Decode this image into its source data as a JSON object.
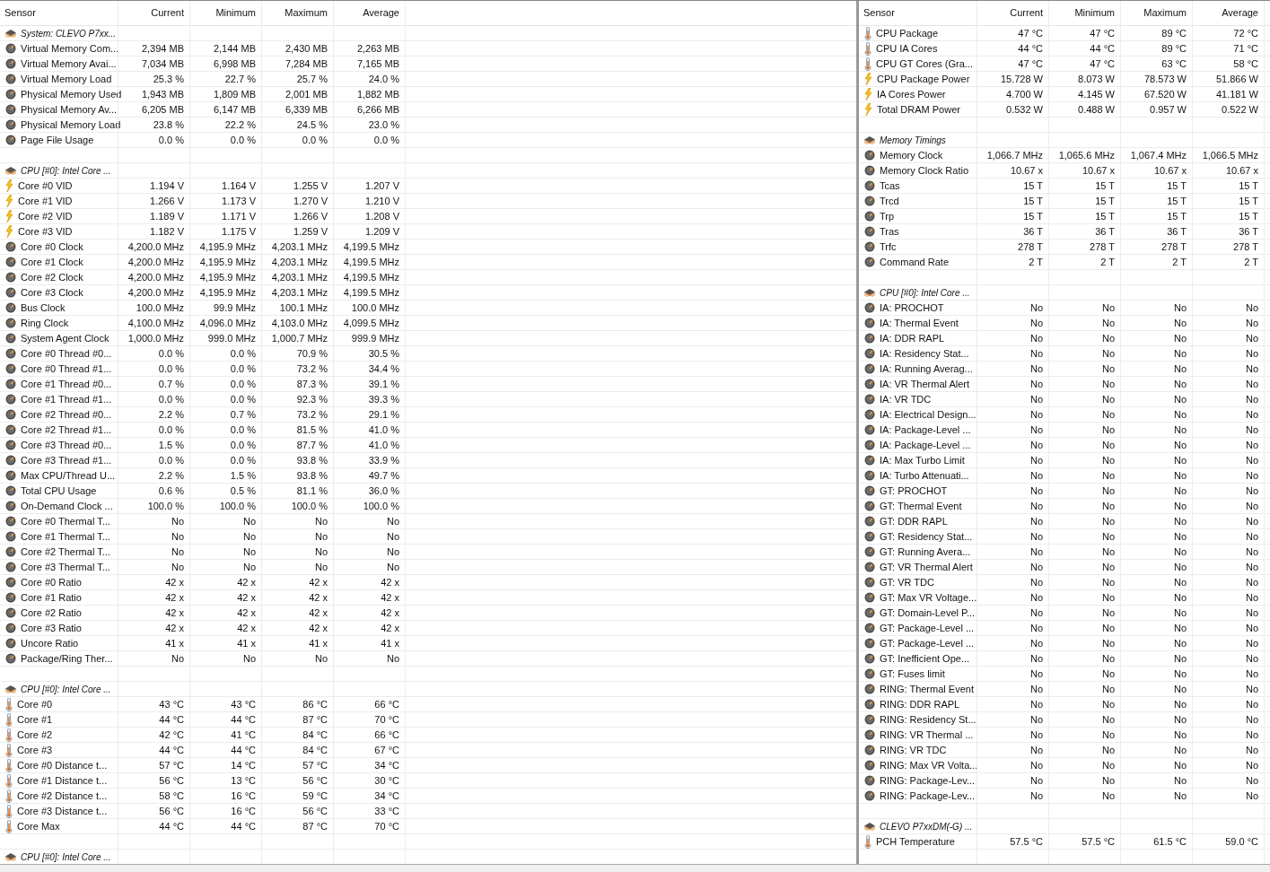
{
  "panels": [
    {
      "columns": [
        "Sensor",
        "Current",
        "Minimum",
        "Maximum",
        "Average"
      ],
      "rows": [
        {
          "kind": "group",
          "label": "System: CLEVO P7xx..."
        },
        {
          "kind": "gauge",
          "label": "Virtual Memory Com...",
          "values": [
            "2,394 MB",
            "2,144 MB",
            "2,430 MB",
            "2,263 MB"
          ]
        },
        {
          "kind": "gauge",
          "label": "Virtual Memory Avai...",
          "values": [
            "7,034 MB",
            "6,998 MB",
            "7,284 MB",
            "7,165 MB"
          ]
        },
        {
          "kind": "gauge",
          "label": "Virtual Memory Load",
          "values": [
            "25.3 %",
            "22.7 %",
            "25.7 %",
            "24.0 %"
          ]
        },
        {
          "kind": "gauge",
          "label": "Physical Memory Used",
          "values": [
            "1,943 MB",
            "1,809 MB",
            "2,001 MB",
            "1,882 MB"
          ]
        },
        {
          "kind": "gauge",
          "label": "Physical Memory Av...",
          "values": [
            "6,205 MB",
            "6,147 MB",
            "6,339 MB",
            "6,266 MB"
          ]
        },
        {
          "kind": "gauge",
          "label": "Physical Memory Load",
          "values": [
            "23.8 %",
            "22.2 %",
            "24.5 %",
            "23.0 %"
          ]
        },
        {
          "kind": "gauge",
          "label": "Page File Usage",
          "values": [
            "0.0 %",
            "0.0 %",
            "0.0 %",
            "0.0 %"
          ]
        },
        {
          "kind": "blank"
        },
        {
          "kind": "group",
          "label": "CPU [#0]: Intel Core ..."
        },
        {
          "kind": "bolt",
          "label": "Core #0 VID",
          "values": [
            "1.194 V",
            "1.164 V",
            "1.255 V",
            "1.207 V"
          ]
        },
        {
          "kind": "bolt",
          "label": "Core #1 VID",
          "values": [
            "1.266 V",
            "1.173 V",
            "1.270 V",
            "1.210 V"
          ]
        },
        {
          "kind": "bolt",
          "label": "Core #2 VID",
          "values": [
            "1.189 V",
            "1.171 V",
            "1.266 V",
            "1.208 V"
          ]
        },
        {
          "kind": "bolt",
          "label": "Core #3 VID",
          "values": [
            "1.182 V",
            "1.175 V",
            "1.259 V",
            "1.209 V"
          ]
        },
        {
          "kind": "gauge",
          "label": "Core #0 Clock",
          "values": [
            "4,200.0 MHz",
            "4,195.9 MHz",
            "4,203.1 MHz",
            "4,199.5 MHz"
          ]
        },
        {
          "kind": "gauge",
          "label": "Core #1 Clock",
          "values": [
            "4,200.0 MHz",
            "4,195.9 MHz",
            "4,203.1 MHz",
            "4,199.5 MHz"
          ]
        },
        {
          "kind": "gauge",
          "label": "Core #2 Clock",
          "values": [
            "4,200.0 MHz",
            "4,195.9 MHz",
            "4,203.1 MHz",
            "4,199.5 MHz"
          ]
        },
        {
          "kind": "gauge",
          "label": "Core #3 Clock",
          "values": [
            "4,200.0 MHz",
            "4,195.9 MHz",
            "4,203.1 MHz",
            "4,199.5 MHz"
          ]
        },
        {
          "kind": "gauge",
          "label": "Bus Clock",
          "values": [
            "100.0 MHz",
            "99.9 MHz",
            "100.1 MHz",
            "100.0 MHz"
          ]
        },
        {
          "kind": "gauge",
          "label": "Ring Clock",
          "values": [
            "4,100.0 MHz",
            "4,096.0 MHz",
            "4,103.0 MHz",
            "4,099.5 MHz"
          ]
        },
        {
          "kind": "gauge",
          "label": "System Agent Clock",
          "values": [
            "1,000.0 MHz",
            "999.0 MHz",
            "1,000.7 MHz",
            "999.9 MHz"
          ]
        },
        {
          "kind": "gauge",
          "label": "Core #0 Thread #0...",
          "values": [
            "0.0 %",
            "0.0 %",
            "70.9 %",
            "30.5 %"
          ]
        },
        {
          "kind": "gauge",
          "label": "Core #0 Thread #1...",
          "values": [
            "0.0 %",
            "0.0 %",
            "73.2 %",
            "34.4 %"
          ]
        },
        {
          "kind": "gauge",
          "label": "Core #1 Thread #0...",
          "values": [
            "0.7 %",
            "0.0 %",
            "87.3 %",
            "39.1 %"
          ]
        },
        {
          "kind": "gauge",
          "label": "Core #1 Thread #1...",
          "values": [
            "0.0 %",
            "0.0 %",
            "92.3 %",
            "39.3 %"
          ]
        },
        {
          "kind": "gauge",
          "label": "Core #2 Thread #0...",
          "values": [
            "2.2 %",
            "0.7 %",
            "73.2 %",
            "29.1 %"
          ]
        },
        {
          "kind": "gauge",
          "label": "Core #2 Thread #1...",
          "values": [
            "0.0 %",
            "0.0 %",
            "81.5 %",
            "41.0 %"
          ]
        },
        {
          "kind": "gauge",
          "label": "Core #3 Thread #0...",
          "values": [
            "1.5 %",
            "0.0 %",
            "87.7 %",
            "41.0 %"
          ]
        },
        {
          "kind": "gauge",
          "label": "Core #3 Thread #1...",
          "values": [
            "0.0 %",
            "0.0 %",
            "93.8 %",
            "33.9 %"
          ]
        },
        {
          "kind": "gauge",
          "label": "Max CPU/Thread U...",
          "values": [
            "2.2 %",
            "1.5 %",
            "93.8 %",
            "49.7 %"
          ]
        },
        {
          "kind": "gauge",
          "label": "Total CPU Usage",
          "values": [
            "0.6 %",
            "0.5 %",
            "81.1 %",
            "36.0 %"
          ]
        },
        {
          "kind": "gauge",
          "label": "On-Demand Clock ...",
          "values": [
            "100.0 %",
            "100.0 %",
            "100.0 %",
            "100.0 %"
          ]
        },
        {
          "kind": "gauge",
          "label": "Core #0 Thermal T...",
          "values": [
            "No",
            "No",
            "No",
            "No"
          ]
        },
        {
          "kind": "gauge",
          "label": "Core #1 Thermal T...",
          "values": [
            "No",
            "No",
            "No",
            "No"
          ]
        },
        {
          "kind": "gauge",
          "label": "Core #2 Thermal T...",
          "values": [
            "No",
            "No",
            "No",
            "No"
          ]
        },
        {
          "kind": "gauge",
          "label": "Core #3 Thermal T...",
          "values": [
            "No",
            "No",
            "No",
            "No"
          ]
        },
        {
          "kind": "gauge",
          "label": "Core #0 Ratio",
          "values": [
            "42 x",
            "42 x",
            "42 x",
            "42 x"
          ]
        },
        {
          "kind": "gauge",
          "label": "Core #1 Ratio",
          "values": [
            "42 x",
            "42 x",
            "42 x",
            "42 x"
          ]
        },
        {
          "kind": "gauge",
          "label": "Core #2 Ratio",
          "values": [
            "42 x",
            "42 x",
            "42 x",
            "42 x"
          ]
        },
        {
          "kind": "gauge",
          "label": "Core #3 Ratio",
          "values": [
            "42 x",
            "42 x",
            "42 x",
            "42 x"
          ]
        },
        {
          "kind": "gauge",
          "label": "Uncore Ratio",
          "values": [
            "41 x",
            "41 x",
            "41 x",
            "41 x"
          ]
        },
        {
          "kind": "gauge",
          "label": "Package/Ring Ther...",
          "values": [
            "No",
            "No",
            "No",
            "No"
          ]
        },
        {
          "kind": "blank"
        },
        {
          "kind": "group",
          "label": "CPU [#0]: Intel Core ..."
        },
        {
          "kind": "thermo",
          "label": "Core #0",
          "values": [
            "43 °C",
            "43 °C",
            "86 °C",
            "66 °C"
          ]
        },
        {
          "kind": "thermo",
          "label": "Core #1",
          "values": [
            "44 °C",
            "44 °C",
            "87 °C",
            "70 °C"
          ]
        },
        {
          "kind": "thermo",
          "label": "Core #2",
          "values": [
            "42 °C",
            "41 °C",
            "84 °C",
            "66 °C"
          ]
        },
        {
          "kind": "thermo",
          "label": "Core #3",
          "values": [
            "44 °C",
            "44 °C",
            "84 °C",
            "67 °C"
          ]
        },
        {
          "kind": "thermo",
          "label": "Core #0 Distance t...",
          "values": [
            "57 °C",
            "14 °C",
            "57 °C",
            "34 °C"
          ]
        },
        {
          "kind": "thermo",
          "label": "Core #1 Distance t...",
          "values": [
            "56 °C",
            "13 °C",
            "56 °C",
            "30 °C"
          ]
        },
        {
          "kind": "thermo",
          "label": "Core #2 Distance t...",
          "values": [
            "58 °C",
            "16 °C",
            "59 °C",
            "34 °C"
          ]
        },
        {
          "kind": "thermo",
          "label": "Core #3 Distance t...",
          "values": [
            "56 °C",
            "16 °C",
            "56 °C",
            "33 °C"
          ]
        },
        {
          "kind": "thermo",
          "label": "Core Max",
          "values": [
            "44 °C",
            "44 °C",
            "87 °C",
            "70 °C"
          ]
        },
        {
          "kind": "blank"
        },
        {
          "kind": "group",
          "label": "CPU [#0]: Intel Core ..."
        }
      ]
    },
    {
      "columns": [
        "Sensor",
        "Current",
        "Minimum",
        "Maximum",
        "Average"
      ],
      "rows": [
        {
          "kind": "thermo",
          "label": "CPU Package",
          "values": [
            "47 °C",
            "47 °C",
            "89 °C",
            "72 °C"
          ]
        },
        {
          "kind": "thermo",
          "label": "CPU IA Cores",
          "values": [
            "44 °C",
            "44 °C",
            "89 °C",
            "71 °C"
          ]
        },
        {
          "kind": "thermo",
          "label": "CPU GT Cores (Gra...",
          "values": [
            "47 °C",
            "47 °C",
            "63 °C",
            "58 °C"
          ]
        },
        {
          "kind": "bolt",
          "label": "CPU Package Power",
          "values": [
            "15.728 W",
            "8.073 W",
            "78.573 W",
            "51.866 W"
          ]
        },
        {
          "kind": "bolt",
          "label": "IA Cores Power",
          "values": [
            "4.700 W",
            "4.145 W",
            "67.520 W",
            "41.181 W"
          ]
        },
        {
          "kind": "bolt",
          "label": "Total DRAM Power",
          "values": [
            "0.532 W",
            "0.488 W",
            "0.957 W",
            "0.522 W"
          ]
        },
        {
          "kind": "blank"
        },
        {
          "kind": "group",
          "label": "Memory Timings"
        },
        {
          "kind": "gauge",
          "label": "Memory Clock",
          "values": [
            "1,066.7 MHz",
            "1,065.6 MHz",
            "1,067.4 MHz",
            "1,066.5 MHz"
          ]
        },
        {
          "kind": "gauge",
          "label": "Memory Clock Ratio",
          "values": [
            "10.67 x",
            "10.67 x",
            "10.67 x",
            "10.67 x"
          ]
        },
        {
          "kind": "gauge",
          "label": "Tcas",
          "values": [
            "15 T",
            "15 T",
            "15 T",
            "15 T"
          ]
        },
        {
          "kind": "gauge",
          "label": "Trcd",
          "values": [
            "15 T",
            "15 T",
            "15 T",
            "15 T"
          ]
        },
        {
          "kind": "gauge",
          "label": "Trp",
          "values": [
            "15 T",
            "15 T",
            "15 T",
            "15 T"
          ]
        },
        {
          "kind": "gauge",
          "label": "Tras",
          "values": [
            "36 T",
            "36 T",
            "36 T",
            "36 T"
          ]
        },
        {
          "kind": "gauge",
          "label": "Trfc",
          "values": [
            "278 T",
            "278 T",
            "278 T",
            "278 T"
          ]
        },
        {
          "kind": "gauge",
          "label": "Command Rate",
          "values": [
            "2 T",
            "2 T",
            "2 T",
            "2 T"
          ]
        },
        {
          "kind": "blank"
        },
        {
          "kind": "group",
          "label": "CPU [#0]: Intel Core ..."
        },
        {
          "kind": "gauge",
          "label": "IA: PROCHOT",
          "values": [
            "No",
            "No",
            "No",
            "No"
          ]
        },
        {
          "kind": "gauge",
          "label": "IA: Thermal Event",
          "values": [
            "No",
            "No",
            "No",
            "No"
          ]
        },
        {
          "kind": "gauge",
          "label": "IA: DDR RAPL",
          "values": [
            "No",
            "No",
            "No",
            "No"
          ]
        },
        {
          "kind": "gauge",
          "label": "IA: Residency Stat...",
          "values": [
            "No",
            "No",
            "No",
            "No"
          ]
        },
        {
          "kind": "gauge",
          "label": "IA: Running Averag...",
          "values": [
            "No",
            "No",
            "No",
            "No"
          ]
        },
        {
          "kind": "gauge",
          "label": "IA: VR Thermal Alert",
          "values": [
            "No",
            "No",
            "No",
            "No"
          ]
        },
        {
          "kind": "gauge",
          "label": "IA: VR TDC",
          "values": [
            "No",
            "No",
            "No",
            "No"
          ]
        },
        {
          "kind": "gauge",
          "label": "IA: Electrical Design...",
          "values": [
            "No",
            "No",
            "No",
            "No"
          ]
        },
        {
          "kind": "gauge",
          "label": "IA: Package-Level ...",
          "values": [
            "No",
            "No",
            "No",
            "No"
          ]
        },
        {
          "kind": "gauge",
          "label": "IA: Package-Level ...",
          "values": [
            "No",
            "No",
            "No",
            "No"
          ]
        },
        {
          "kind": "gauge",
          "label": "IA: Max Turbo Limit",
          "values": [
            "No",
            "No",
            "No",
            "No"
          ]
        },
        {
          "kind": "gauge",
          "label": "IA: Turbo Attenuati...",
          "values": [
            "No",
            "No",
            "No",
            "No"
          ]
        },
        {
          "kind": "gauge",
          "label": "GT: PROCHOT",
          "values": [
            "No",
            "No",
            "No",
            "No"
          ]
        },
        {
          "kind": "gauge",
          "label": "GT: Thermal Event",
          "values": [
            "No",
            "No",
            "No",
            "No"
          ]
        },
        {
          "kind": "gauge",
          "label": "GT: DDR RAPL",
          "values": [
            "No",
            "No",
            "No",
            "No"
          ]
        },
        {
          "kind": "gauge",
          "label": "GT: Residency Stat...",
          "values": [
            "No",
            "No",
            "No",
            "No"
          ]
        },
        {
          "kind": "gauge",
          "label": "GT: Running Avera...",
          "values": [
            "No",
            "No",
            "No",
            "No"
          ]
        },
        {
          "kind": "gauge",
          "label": "GT: VR Thermal Alert",
          "values": [
            "No",
            "No",
            "No",
            "No"
          ]
        },
        {
          "kind": "gauge",
          "label": "GT: VR TDC",
          "values": [
            "No",
            "No",
            "No",
            "No"
          ]
        },
        {
          "kind": "gauge",
          "label": "GT: Max VR Voltage...",
          "values": [
            "No",
            "No",
            "No",
            "No"
          ]
        },
        {
          "kind": "gauge",
          "label": "GT: Domain-Level P...",
          "values": [
            "No",
            "No",
            "No",
            "No"
          ]
        },
        {
          "kind": "gauge",
          "label": "GT: Package-Level ...",
          "values": [
            "No",
            "No",
            "No",
            "No"
          ]
        },
        {
          "kind": "gauge",
          "label": "GT: Package-Level ...",
          "values": [
            "No",
            "No",
            "No",
            "No"
          ]
        },
        {
          "kind": "gauge",
          "label": "GT: Inefficient Ope...",
          "values": [
            "No",
            "No",
            "No",
            "No"
          ]
        },
        {
          "kind": "gauge",
          "label": "GT: Fuses limit",
          "values": [
            "No",
            "No",
            "No",
            "No"
          ]
        },
        {
          "kind": "gauge",
          "label": "RING: Thermal Event",
          "values": [
            "No",
            "No",
            "No",
            "No"
          ]
        },
        {
          "kind": "gauge",
          "label": "RING: DDR RAPL",
          "values": [
            "No",
            "No",
            "No",
            "No"
          ]
        },
        {
          "kind": "gauge",
          "label": "RING: Residency St...",
          "values": [
            "No",
            "No",
            "No",
            "No"
          ]
        },
        {
          "kind": "gauge",
          "label": "RING: VR Thermal ...",
          "values": [
            "No",
            "No",
            "No",
            "No"
          ]
        },
        {
          "kind": "gauge",
          "label": "RING: VR TDC",
          "values": [
            "No",
            "No",
            "No",
            "No"
          ]
        },
        {
          "kind": "gauge",
          "label": "RING: Max VR Volta...",
          "values": [
            "No",
            "No",
            "No",
            "No"
          ]
        },
        {
          "kind": "gauge",
          "label": "RING: Package-Lev...",
          "values": [
            "No",
            "No",
            "No",
            "No"
          ]
        },
        {
          "kind": "gauge",
          "label": "RING: Package-Lev...",
          "values": [
            "No",
            "No",
            "No",
            "No"
          ]
        },
        {
          "kind": "blank"
        },
        {
          "kind": "group",
          "label": "CLEVO P7xxDM(-G) ..."
        },
        {
          "kind": "thermo",
          "label": "PCH Temperature",
          "values": [
            "57.5 °C",
            "57.5 °C",
            "61.5 °C",
            "59.0 °C"
          ]
        },
        {
          "kind": "blank"
        }
      ]
    }
  ]
}
